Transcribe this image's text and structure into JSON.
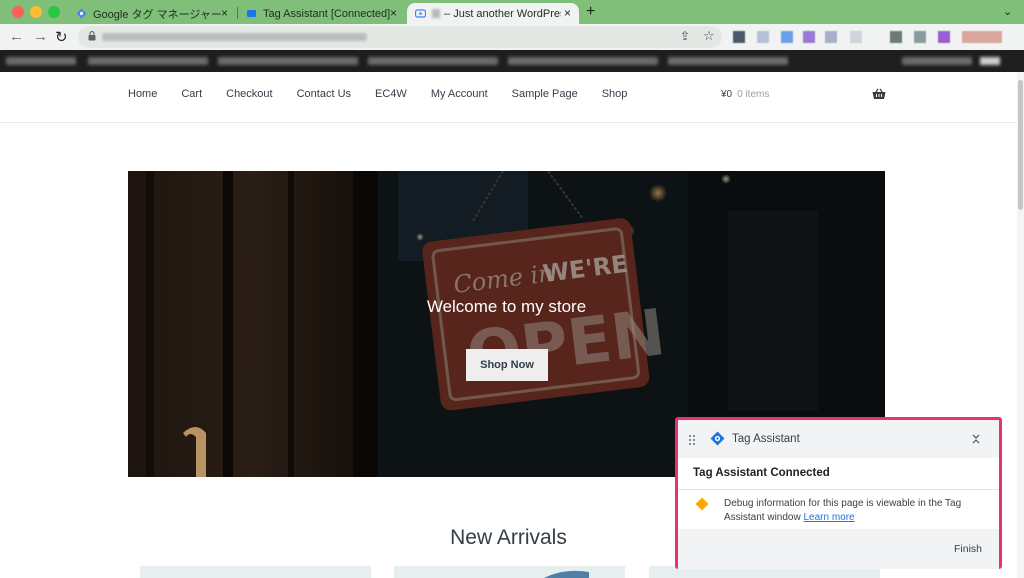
{
  "browser": {
    "tabs": [
      {
        "title": "Google タグ マネージャー",
        "close": "×"
      },
      {
        "title": "Tag Assistant [Connected]",
        "close": "×"
      },
      {
        "title": "– Just another WordPress",
        "close": "×"
      }
    ],
    "new_tab": "+",
    "tab_menu": "⌄",
    "back": "←",
    "forward": "→",
    "reload": "↻",
    "share": "⇪",
    "bookmark_star": "☆"
  },
  "site": {
    "nav": [
      "Home",
      "Cart",
      "Checkout",
      "Contact Us",
      "EC4W",
      "My Account",
      "Sample Page",
      "Shop"
    ],
    "cart_total": "¥0",
    "cart_items": "0 items"
  },
  "hero": {
    "title": "Welcome to my store",
    "button": "Shop Now",
    "sign_line1": "Come in",
    "sign_line2": "WE'RE",
    "sign_line3": "OPEN"
  },
  "section": {
    "title": "New Arrivals"
  },
  "tag_assistant": {
    "name": "Tag Assistant",
    "status": "Tag Assistant Connected",
    "message": "Debug information for this page is viewable in the Tag Assistant window",
    "link": "Learn more",
    "finish": "Finish",
    "colors": {
      "border": "#e6326f",
      "link": "#1a73e8",
      "warning": "#f9ab00"
    }
  }
}
